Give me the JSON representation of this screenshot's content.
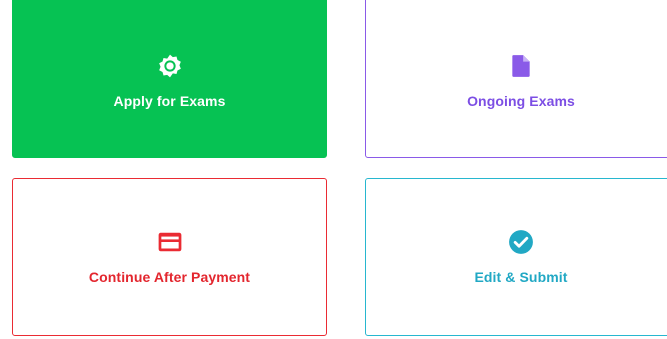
{
  "cards": [
    {
      "label": "Apply for Exams",
      "icon": "gear-icon",
      "color": "#06c253"
    },
    {
      "label": "Ongoing Exams",
      "icon": "document-icon",
      "color": "#7c4ee4"
    },
    {
      "label": "Continue After Payment",
      "icon": "credit-card-icon",
      "color": "#e3262e"
    },
    {
      "label": "Edit & Submit",
      "icon": "check-circle-icon",
      "color": "#21a8c4"
    }
  ]
}
